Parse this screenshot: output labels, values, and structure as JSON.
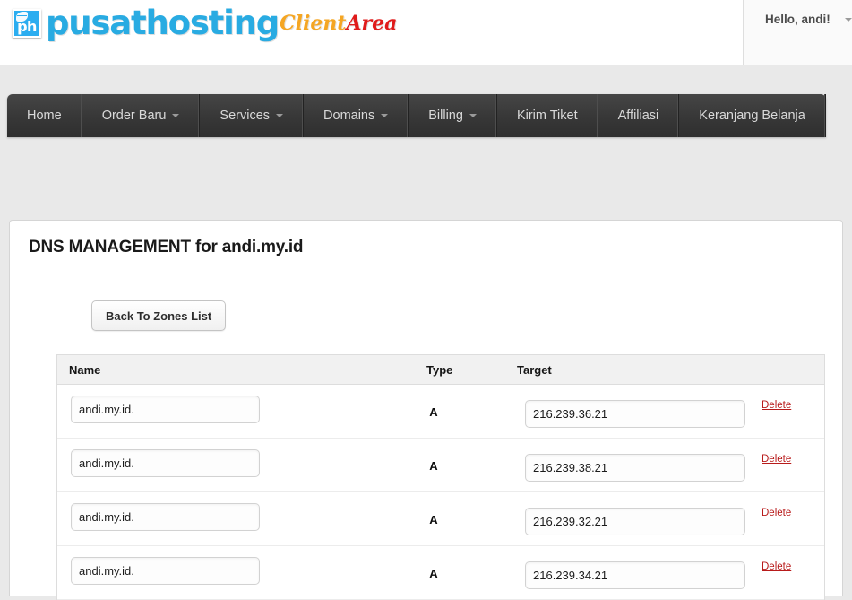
{
  "header": {
    "logo": {
      "mark_text": "ph",
      "word": "pusathosting",
      "client": "Client",
      "area": "Area"
    },
    "user_greeting": "Hello, andi!"
  },
  "nav": {
    "items": [
      {
        "label": "Home",
        "has_caret": false
      },
      {
        "label": "Order Baru",
        "has_caret": true
      },
      {
        "label": "Services",
        "has_caret": true
      },
      {
        "label": "Domains",
        "has_caret": true
      },
      {
        "label": "Billing",
        "has_caret": true
      },
      {
        "label": "Kirim Tiket",
        "has_caret": false
      },
      {
        "label": "Affiliasi",
        "has_caret": false
      },
      {
        "label": "Keranjang Belanja",
        "has_caret": false
      }
    ]
  },
  "main": {
    "page_title": "DNS MANAGEMENT for andi.my.id",
    "back_button": "Back To Zones List",
    "table": {
      "columns": [
        "Name",
        "Type",
        "Target"
      ],
      "delete_label": "Delete",
      "rows": [
        {
          "name": "andi.my.id.",
          "type": "A",
          "target": "216.239.36.21",
          "delete": "Delete"
        },
        {
          "name": "andi.my.id.",
          "type": "A",
          "target": "216.239.38.21",
          "delete": "Delete"
        },
        {
          "name": "andi.my.id.",
          "type": "A",
          "target": "216.239.32.21",
          "delete": "Delete"
        },
        {
          "name": "andi.my.id.",
          "type": "A",
          "target": "216.239.34.21",
          "delete": "Delete"
        }
      ]
    }
  },
  "colors": {
    "logo_blue": "#29abe2",
    "client_orange": "#f5a623",
    "area_red": "#e01b1b",
    "nav_dark": "#3a3a3a",
    "delete_red": "#b81b1b",
    "page_bg": "#e9e9e9"
  }
}
